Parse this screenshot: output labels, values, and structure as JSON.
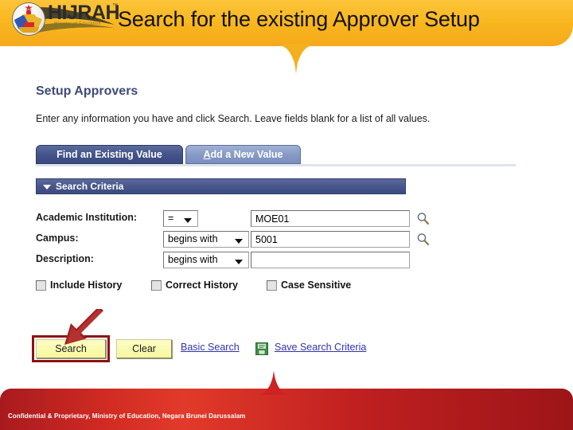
{
  "banner": {
    "title": "Search for the existing Approver Setup",
    "logo_text": "HIJRAH",
    "logo_tm": "™",
    "logo_sub": "Ministry of Education",
    "logo_icon": "brunei-crest-logo",
    "bg_color": "#f9b81f"
  },
  "page": {
    "title": "Setup Approvers",
    "instructions": "Enter any information you have and click Search. Leave fields blank for a list of all values."
  },
  "tabs": [
    {
      "label": "Find an Existing Value",
      "active": true
    },
    {
      "label": "Add a New Value",
      "active": false,
      "accesskey": "A"
    }
  ],
  "criteria": {
    "collapse_icon": "triangle-down-icon",
    "label": "Search Criteria",
    "header_color": "#46558a"
  },
  "fields": [
    {
      "label": "Academic Institution:",
      "operator": "=",
      "operator_width": "narrow",
      "value": "MOE01",
      "placeholder": "",
      "lookup_icon": "magnifier-icon",
      "has_lookup": true
    },
    {
      "label": "Campus:",
      "operator": "begins with",
      "operator_width": "wide",
      "value": "5001",
      "placeholder": "",
      "lookup_icon": "magnifier-icon",
      "has_lookup": true
    },
    {
      "label": "Description:",
      "operator": "begins with",
      "operator_width": "wide",
      "value": "",
      "placeholder": "",
      "lookup_icon": "magnifier-icon",
      "has_lookup": false
    }
  ],
  "checkboxes": [
    {
      "label": "Include History",
      "checked": false
    },
    {
      "label": "Correct History",
      "checked": false
    },
    {
      "label": "Case Sensitive",
      "checked": false
    }
  ],
  "actions": {
    "search_label": "Search",
    "clear_label": "Clear",
    "basic_search_label": "Basic Search",
    "save_criteria_label": "Save Search Criteria",
    "save_icon": "floppy-disk-save-icon",
    "highlight_color": "#8d1212",
    "annotation_icon": "red-arrow-pointing-down-left"
  },
  "footer": {
    "text": "Confidential & Proprietary, Ministry of Education, Negara Brunei Darussalam",
    "bg_color": "#c02020"
  }
}
